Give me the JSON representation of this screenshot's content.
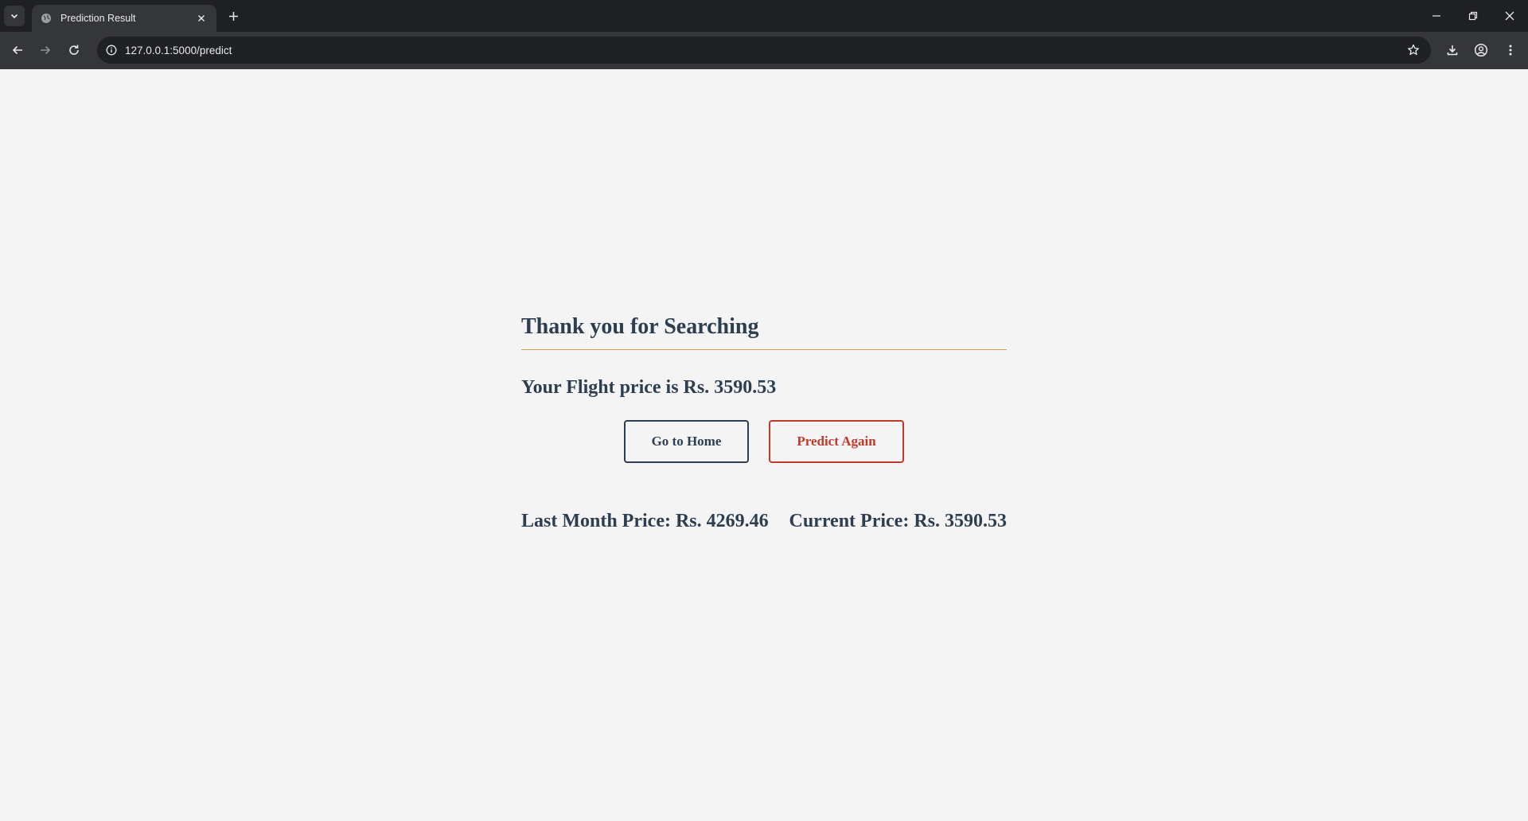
{
  "browser": {
    "tab_title": "Prediction Result",
    "url": "127.0.0.1:5000/predict"
  },
  "page": {
    "heading": "Thank you for Searching",
    "price_text": "Your Flight price is Rs. 3590.53",
    "buttons": {
      "home": "Go to Home",
      "again": "Predict Again"
    },
    "last_month": "Last Month Price: Rs. 4269.46",
    "current": "Current Price: Rs. 3590.53"
  },
  "colors": {
    "text": "#2c3e50",
    "accent_line": "#c9a15b",
    "predict_again": "#c0392b",
    "background": "#f4f4f4"
  }
}
